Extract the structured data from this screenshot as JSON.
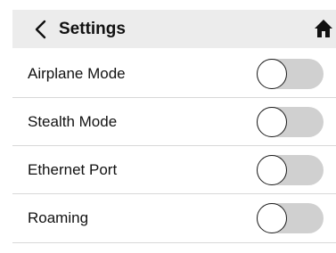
{
  "header": {
    "title": "Settings",
    "back_icon": "chevron-left-icon",
    "home_icon": "home-icon",
    "background": "#ececec"
  },
  "settings": [
    {
      "label": "Airplane Mode",
      "enabled": false
    },
    {
      "label": "Stealth Mode",
      "enabled": false
    },
    {
      "label": "Ethernet Port",
      "enabled": false
    },
    {
      "label": "Roaming",
      "enabled": false
    }
  ],
  "colors": {
    "toggle_track_off": "#d0d0d0",
    "toggle_knob": "#ffffff",
    "divider": "#d8d8d8",
    "text": "#111111"
  }
}
